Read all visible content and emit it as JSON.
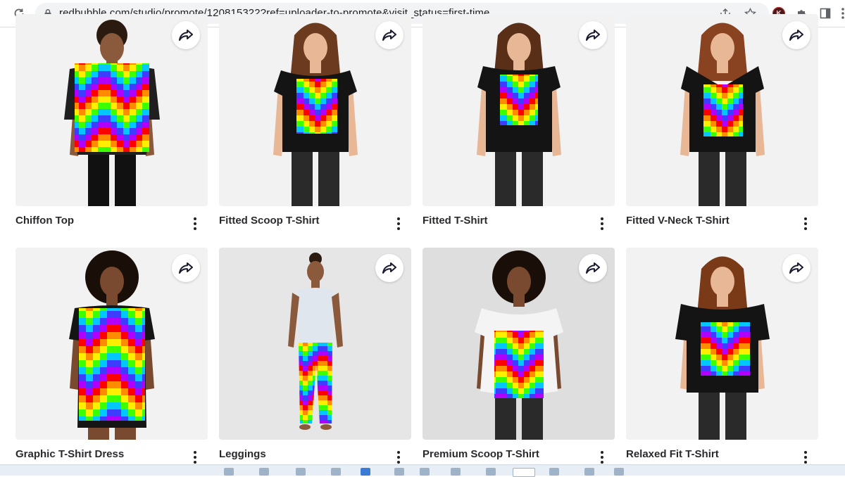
{
  "browser": {
    "url": "redbubble.com/studio/promote/120815322?ref=uploader-to-promote&visit_status=first-time",
    "profile_initial": "K"
  },
  "products": [
    {
      "title": "Chiffon Top"
    },
    {
      "title": "Fitted Scoop T-Shirt"
    },
    {
      "title": "Fitted T-Shirt"
    },
    {
      "title": "Fitted V-Neck T-Shirt"
    },
    {
      "title": "Graphic T-Shirt Dress"
    },
    {
      "title": "Leggings"
    },
    {
      "title": "Premium Scoop T-Shirt"
    },
    {
      "title": "Relaxed Fit T-Shirt"
    }
  ],
  "icons": {
    "share": "share-arrow-icon",
    "more": "more-vertical-icon"
  },
  "colors": {
    "rainbow": [
      "#ff0000",
      "#ff8c00",
      "#ffee00",
      "#3cff00",
      "#00c8ff",
      "#3d3dff",
      "#b000ff"
    ],
    "text": "#2a2a2e",
    "card_bg": "#f2f2f2"
  }
}
